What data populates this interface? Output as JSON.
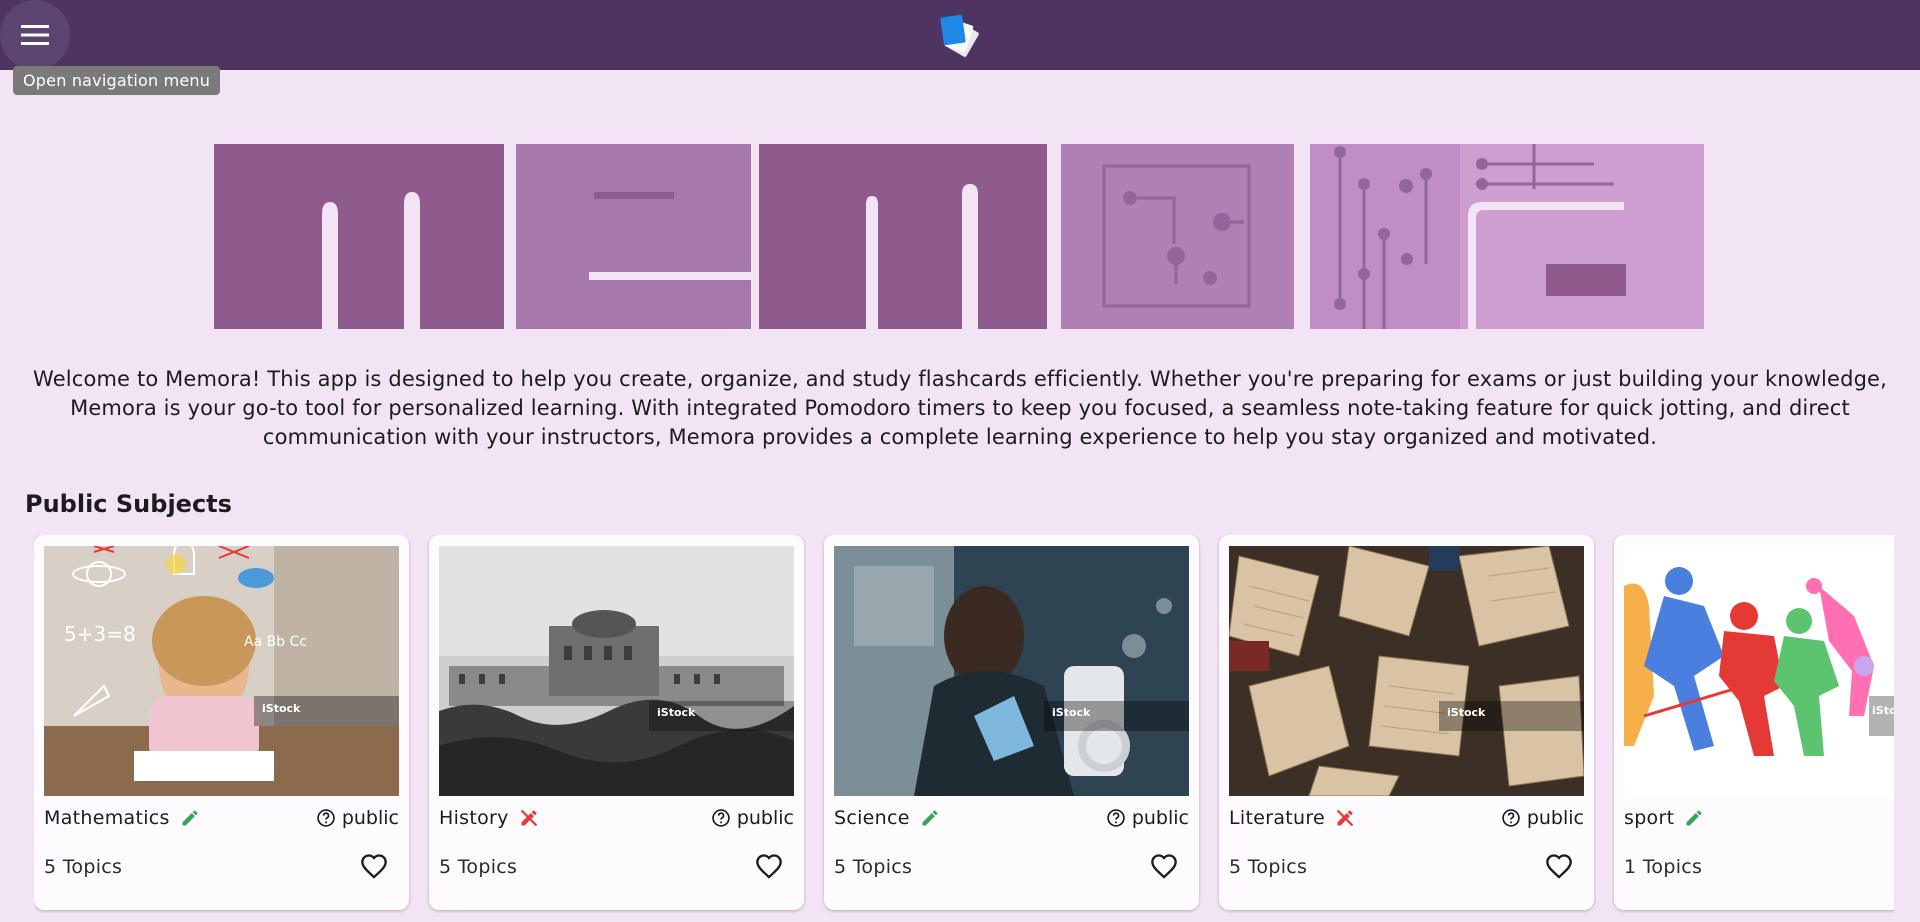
{
  "nav": {
    "tooltip": "Open navigation menu",
    "menu_icon": "hamburger-menu-icon",
    "logo_icon": "flashcards-logo-icon"
  },
  "banner": {
    "wordmark": "Memora"
  },
  "intro": {
    "text": "Welcome to Memora! This app is designed to help you create, organize, and study flashcards efficiently. Whether you're preparing for exams or just building your knowledge, Memora is your go-to tool for personalized learning. With integrated Pomodoro timers to keep you focused, a seamless note-taking feature for quick jotting, and direct communication with your instructors, Memora provides a complete learning experience to help you stay organized and motivated."
  },
  "section": {
    "title": "Public Subjects"
  },
  "subjects": [
    {
      "name": "Mathematics",
      "editable": true,
      "visibility": "public",
      "topics": "5 Topics",
      "watermark": "iStock"
    },
    {
      "name": "History",
      "editable": false,
      "visibility": "public",
      "topics": "5 Topics",
      "watermark": "iStock"
    },
    {
      "name": "Science",
      "editable": true,
      "visibility": "public",
      "topics": "5 Topics",
      "watermark": "iStock"
    },
    {
      "name": "Literature",
      "editable": false,
      "visibility": "public",
      "topics": "5 Topics",
      "watermark": "iStock"
    },
    {
      "name": "sport",
      "editable": true,
      "visibility": "",
      "topics": "1 Topics",
      "watermark": "iSto"
    }
  ],
  "colors": {
    "appbar": "#4e3461",
    "background": "#f3e4f5",
    "edit_green": "#34a853",
    "no_edit_red": "#e53935"
  }
}
